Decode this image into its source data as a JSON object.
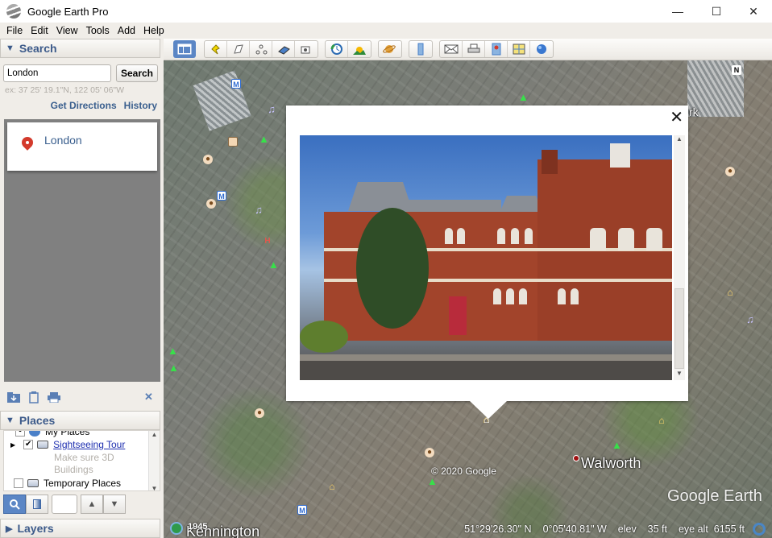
{
  "window": {
    "title": "Google Earth Pro",
    "controls": {
      "minimize": "—",
      "maximize": "☐",
      "close": "✕"
    }
  },
  "menu": [
    "File",
    "Edit",
    "View",
    "Tools",
    "Add",
    "Help"
  ],
  "search_panel": {
    "header": "Search",
    "input_value": "London",
    "search_button": "Search",
    "hint": "ex: 37 25' 19.1\"N, 122 05' 06\"W",
    "get_directions": "Get Directions",
    "history": "History",
    "results": [
      {
        "label": "London",
        "icon": "red-pin-icon"
      }
    ]
  },
  "panel_tools": {
    "add_folder": "folder-add-icon",
    "copy": "clipboard-icon",
    "print": "print-icon",
    "close": "✕"
  },
  "places": {
    "header": "Places",
    "items": [
      {
        "label": "My Places",
        "checked": true
      },
      {
        "label": "Sightseeing Tour",
        "checked": true,
        "link": true
      },
      {
        "label": "Make sure 3D",
        "note": true
      },
      {
        "label": "Buildings",
        "note": true
      },
      {
        "label": "Temporary Places",
        "checked": false
      }
    ]
  },
  "nav_buttons": {
    "search": "🔍",
    "sidebar": "▮",
    "up": "▲",
    "down": "▼"
  },
  "layers": {
    "header": "Layers"
  },
  "toolbar": {
    "buttons": [
      "sidebar-toggle-icon",
      "placemark-add-icon",
      "polygon-add-icon",
      "path-add-icon",
      "overlay-add-icon",
      "tour-record-icon",
      "historical-imagery-icon",
      "sunlight-icon",
      "planet-switch-icon",
      "ruler-icon",
      "email-icon",
      "print-icon",
      "save-image-icon",
      "view-in-maps-icon",
      "sign-in-icon"
    ]
  },
  "map": {
    "labels": [
      {
        "text": "Walworth"
      },
      {
        "text": "Kennington"
      },
      {
        "text": "rk"
      }
    ],
    "copyright": "© 2020 Google",
    "logo": "Google Earth",
    "historical_year": "1945",
    "compass": "N",
    "status": {
      "lat": "51°29'26.30\" N",
      "lon": "0°05'40.81\" W",
      "elev_label": "elev",
      "elev_value": "35 ft",
      "eye_alt_label": "eye alt",
      "eye_alt_value": "6155 ft"
    }
  },
  "popup": {
    "close": "✕",
    "photo_description": "Red-brick Victorian building with slate roofs on a sunny street"
  }
}
